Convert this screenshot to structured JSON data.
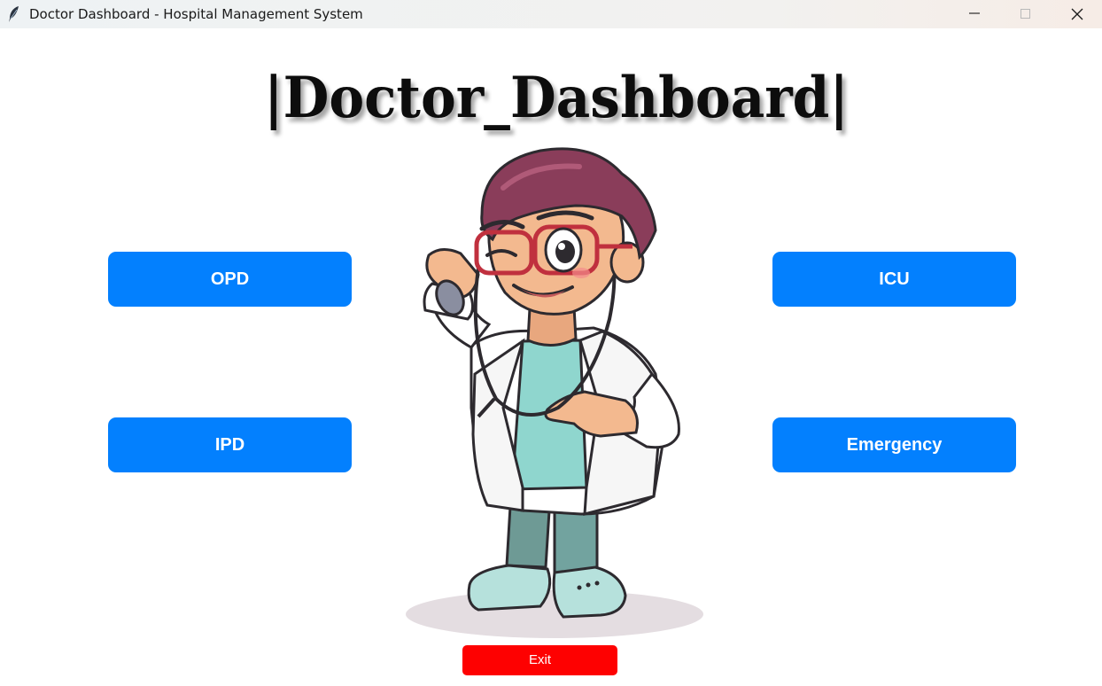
{
  "window": {
    "title": "Doctor Dashboard - Hospital Management System",
    "controls": [
      "minimize-icon",
      "maximize-icon",
      "close-icon"
    ]
  },
  "heading": {
    "text": "|Doctor_Dashboard|"
  },
  "buttons": {
    "opd": "OPD",
    "icu": "ICU",
    "ipd": "IPD",
    "emergency": "Emergency",
    "exit": "Exit"
  },
  "colors": {
    "primary_button": "#0380fe",
    "exit_button": "#fe0101",
    "button_text": "#ffffff",
    "background": "#ffffff"
  },
  "illustration": {
    "icon": "doctor-illustration"
  }
}
